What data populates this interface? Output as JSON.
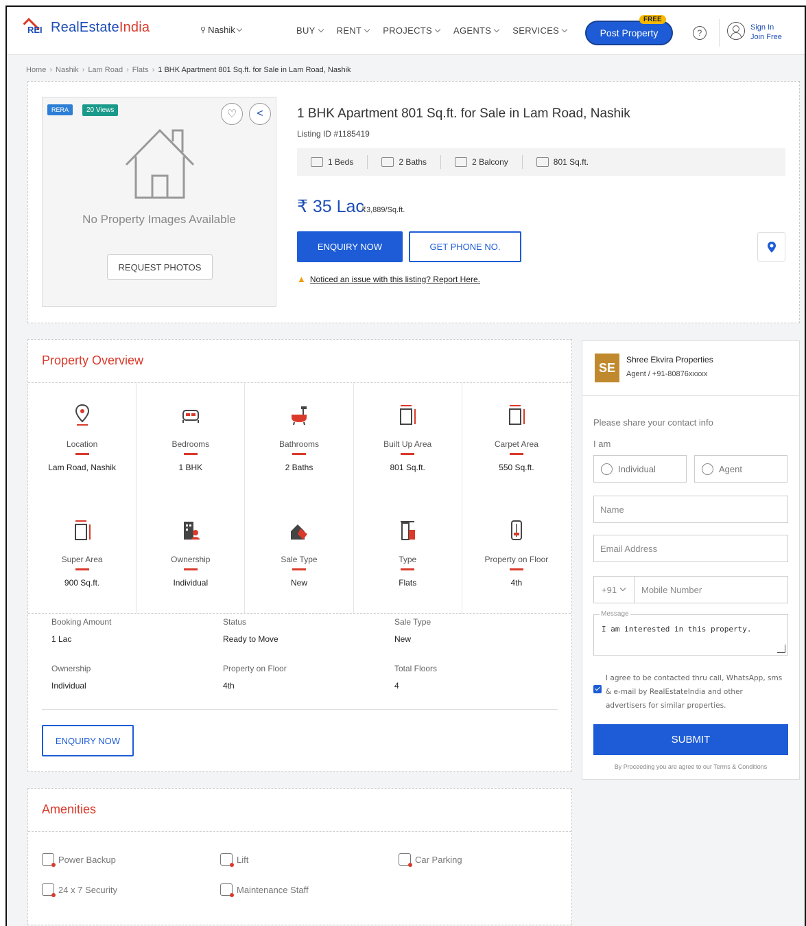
{
  "header": {
    "logo_mark": "REI",
    "logo_text_1": "RealEstate",
    "logo_text_2": "India",
    "city": "Nashik",
    "nav": [
      "BUY",
      "RENT",
      "PROJECTS",
      "AGENTS",
      "SERVICES"
    ],
    "post_property": "Post Property",
    "free_tag": "FREE",
    "help": "?",
    "sign_in": "Sign In",
    "join_free": "Join Free"
  },
  "breadcrumb": [
    "Home",
    "Nashik",
    "Lam Road",
    "Flats",
    "1 BHK Apartment 801 Sq.ft. for Sale in Lam Road, Nashik"
  ],
  "listing": {
    "rera_badge": "RERA",
    "views_badge": "20 Views",
    "no_images": "No Property Images Available",
    "request_photos": "REQUEST PHOTOS",
    "title": "1 BHK Apartment 801 Sq.ft. for Sale in Lam Road, Nashik",
    "listing_id": "Listing ID #1185419",
    "specs": [
      {
        "icon": "bed-icon",
        "label": "1 Beds"
      },
      {
        "icon": "bath-icon",
        "label": "2 Baths"
      },
      {
        "icon": "balcony-icon",
        "label": "2 Balcony"
      },
      {
        "icon": "area-icon",
        "label": "801 Sq.ft."
      }
    ],
    "price": "₹ 35 Lac",
    "price_per_sqft": "₹3,889/Sq.ft.",
    "enquiry_now": "ENQUIRY NOW",
    "get_phone": "GET PHONE NO.",
    "report_text": "Noticed an issue with this listing? Report Here."
  },
  "overview": {
    "title": "Property Overview",
    "cells": [
      {
        "icon": "location-icon",
        "label": "Location",
        "value": "Lam Road, Nashik"
      },
      {
        "icon": "bedroom-icon",
        "label": "Bedrooms",
        "value": "1 BHK"
      },
      {
        "icon": "bathroom-icon",
        "label": "Bathrooms",
        "value": "2 Baths"
      },
      {
        "icon": "built-up-area-icon",
        "label": "Built Up Area",
        "value": "801 Sq.ft."
      },
      {
        "icon": "carpet-area-icon",
        "label": "Carpet Area",
        "value": "550 Sq.ft."
      },
      {
        "icon": "super-area-icon",
        "label": "Super Area",
        "value": "900 Sq.ft."
      },
      {
        "icon": "ownership-icon",
        "label": "Ownership",
        "value": "Individual"
      },
      {
        "icon": "sale-type-icon",
        "label": "Sale Type",
        "value": "New"
      },
      {
        "icon": "type-icon",
        "label": "Type",
        "value": "Flats"
      },
      {
        "icon": "floor-icon",
        "label": "Property on Floor",
        "value": "4th"
      }
    ],
    "details": [
      {
        "label": "Booking Amount",
        "value": "1 Lac"
      },
      {
        "label": "Status",
        "value": "Ready to Move"
      },
      {
        "label": "Sale Type",
        "value": "New"
      },
      {
        "label": "Ownership",
        "value": "Individual"
      },
      {
        "label": "Property on Floor",
        "value": "4th"
      },
      {
        "label": "Total Floors",
        "value": "4"
      }
    ],
    "enquiry_now": "ENQUIRY NOW"
  },
  "contact": {
    "agent_initials": "SE",
    "agent_name": "Shree Ekvira Properties",
    "agent_sub": "Agent / +91-80876xxxxx",
    "share_info": "Please share your contact info",
    "i_am": "I am",
    "individual": "Individual",
    "agent": "Agent",
    "name_placeholder": "Name",
    "email_placeholder": "Email Address",
    "country_code": "+91",
    "mobile_placeholder": "Mobile Number",
    "message_label": "Message",
    "message_text": "I am interested in this property.",
    "agree_text": "I agree to be contacted thru call, WhatsApp, sms & e-mail by RealEstateIndia and other advertisers for similar properties.",
    "submit": "SUBMIT",
    "terms_text": "By Proceeding you are agree to our Terms & Conditions"
  },
  "amenities": {
    "title": "Amenities",
    "items": [
      "Power Backup",
      "Lift",
      "Car Parking",
      "24 x 7 Security",
      "Maintenance Staff"
    ]
  },
  "colors": {
    "brand_blue": "#1d5cd6",
    "brand_red": "#d93a2b",
    "free_yellow": "#f6b800",
    "agent_gold": "#c0892d"
  }
}
